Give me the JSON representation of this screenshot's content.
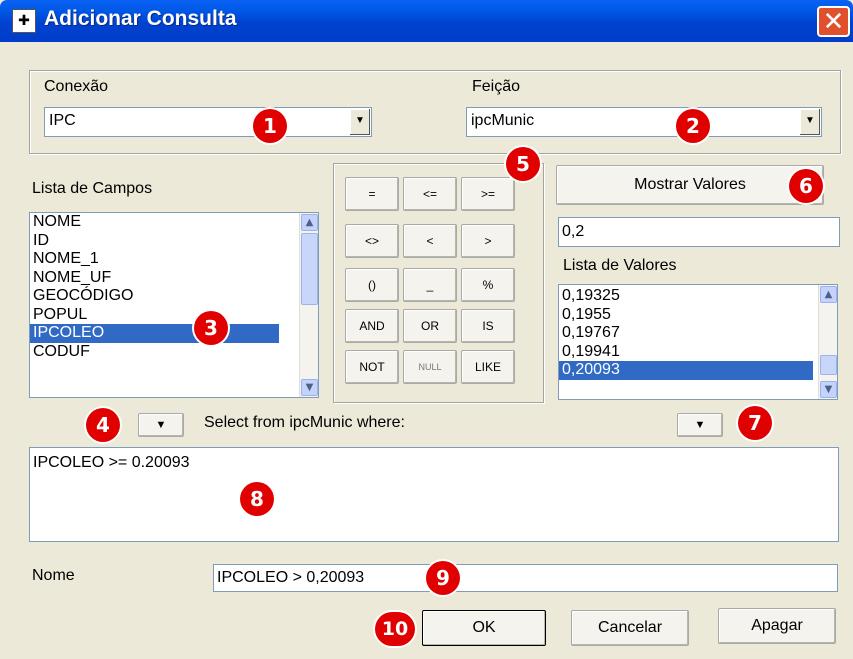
{
  "window": {
    "title": "Adicionar Consulta",
    "icon_glyph": "✚",
    "close_glyph": "✕"
  },
  "connection": {
    "label": "Conexão",
    "value": "IPC"
  },
  "feature": {
    "label": "Feição",
    "value": "ipcMunic"
  },
  "fields": {
    "label": "Lista de Campos",
    "items": [
      "NOME",
      "ID",
      "NOME_1",
      "NOME_UF",
      "GEOCÓDIGO",
      "POPUL",
      "IPCOLEO",
      "CODUF"
    ],
    "selected": "IPCOLEO"
  },
  "operators": [
    [
      "=",
      "<=",
      ">="
    ],
    [
      "<>",
      "<",
      ">"
    ],
    [
      "()",
      "_",
      "%"
    ],
    [
      "AND",
      "OR",
      "IS"
    ],
    [
      "NOT",
      "NULL",
      "LIKE"
    ]
  ],
  "values": {
    "show_button": "Mostrar Valores",
    "input_value": "0,2",
    "label": "Lista de Valores",
    "items": [
      "0,19325",
      "0,1955",
      "0,19767",
      "0,19941",
      "0,20093"
    ],
    "selected": "0,20093"
  },
  "query": {
    "select_label": "Select from ipcMunic where:",
    "expression": "IPCOLEO >= 0.20093"
  },
  "name": {
    "label": "Nome",
    "value": "IPCOLEO > 0,20093"
  },
  "buttons": {
    "ok": "OK",
    "cancel": "Cancelar",
    "clear": "Apagar"
  },
  "callouts": [
    "1",
    "2",
    "3",
    "4",
    "5",
    "6",
    "7",
    "8",
    "9",
    "10"
  ],
  "colors": {
    "titlebar": "#0054e3",
    "selection": "#316ac5",
    "callout": "#e00000",
    "close": "#e0502d"
  },
  "icons": {
    "dropdown": "▼",
    "scroll_up": "▲",
    "scroll_down": "▼"
  }
}
